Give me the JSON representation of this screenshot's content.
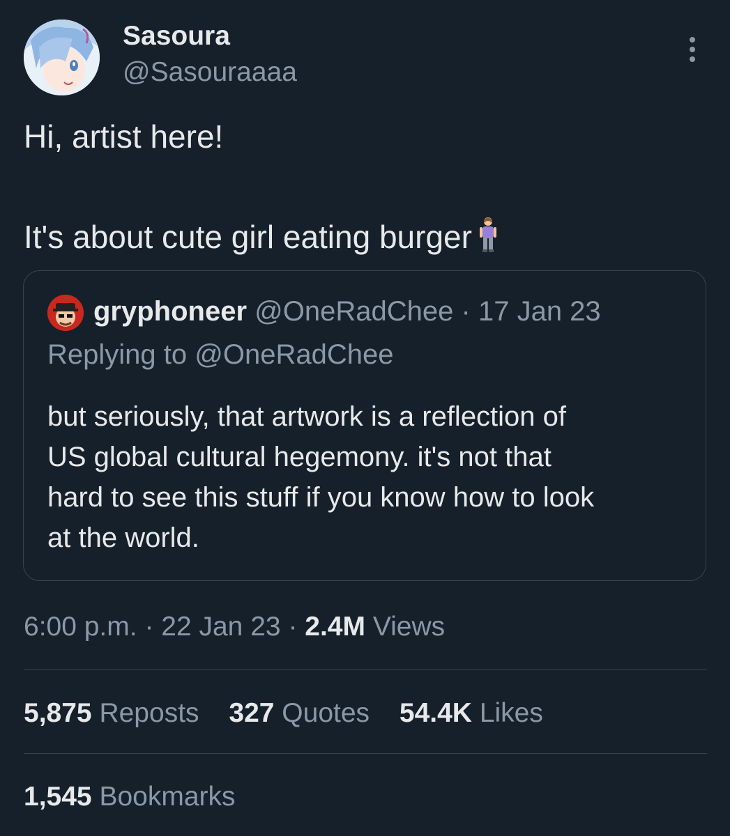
{
  "author": {
    "display_name": "Sasoura",
    "handle": "@Sasouraaaa",
    "avatar_icon": "anime-avatar"
  },
  "more_icon": "more-vertical-icon",
  "tweet": {
    "line1": "Hi, artist here!",
    "line2": "It's about cute girl eating burger",
    "emoji_icon": "standing-woman-emoji"
  },
  "quote": {
    "display_name": "gryphoneer",
    "handle": "@OneRadChee",
    "separator": "·",
    "date": "17 Jan 23",
    "replying_label": "Replying to",
    "replying_handle": "@OneRadChee",
    "body_lines": [
      "but seriously, that artwork is a reflection of",
      "US global cultural hegemony. it's not that",
      "hard to see this stuff if you know how to look",
      "at the world."
    ]
  },
  "meta": {
    "time": "6:00 p.m.",
    "separator": "·",
    "date": "22 Jan 23",
    "views_count": "2.4M",
    "views_label": "Views"
  },
  "stats": {
    "reposts_count": "5,875",
    "reposts_label": "Reposts",
    "quotes_count": "327",
    "quotes_label": "Quotes",
    "likes_count": "54.4K",
    "likes_label": "Likes",
    "bookmarks_count": "1,545",
    "bookmarks_label": "Bookmarks"
  },
  "colors": {
    "background": "#15202b",
    "text_primary": "#e7e9ea",
    "text_secondary": "#8b98a5",
    "border": "#38444d"
  }
}
